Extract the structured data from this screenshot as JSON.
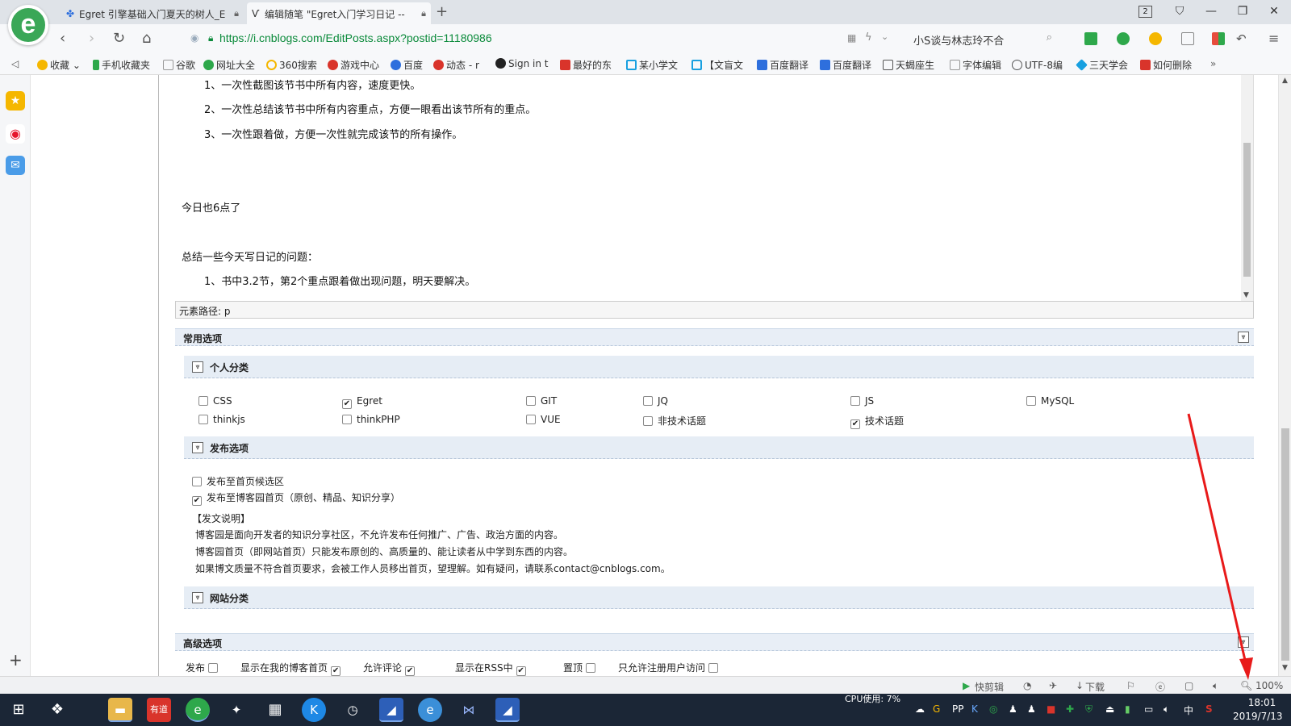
{
  "browser": {
    "tabs": [
      {
        "title": "Egret 引擎基础入门夏天的树人_E",
        "icon": "paw-icon"
      },
      {
        "title": "编辑随笔 \"Egret入门学习日记 --",
        "icon": "cnblogs-icon"
      }
    ],
    "tab_count": "2",
    "url": "https://i.cnblogs.com/EditPosts.aspx?postid=11180986",
    "search_text": "小S谈与林志玲不合",
    "accent_color": "#3aa757"
  },
  "bookmarks": [
    {
      "label": "收藏",
      "color": "#f5b700"
    },
    {
      "label": "手机收藏夹",
      "color": "#2ea84b"
    },
    {
      "label": "谷歌",
      "color": "#bbbbbb"
    },
    {
      "label": "网址大全",
      "color": "#2ea84b"
    },
    {
      "label": "360搜索",
      "color": "#f5b700"
    },
    {
      "label": "游戏中心",
      "color": "#d9342b"
    },
    {
      "label": "百度",
      "color": "#2e6fdd"
    },
    {
      "label": "动态 - r",
      "color": "#d9342b"
    },
    {
      "label": "Sign in t",
      "color": "#222222"
    },
    {
      "label": "最好的东",
      "color": "#d9342b"
    },
    {
      "label": "某小学文",
      "color": "#18a0e0"
    },
    {
      "label": "【文盲文",
      "color": "#18a0e0"
    },
    {
      "label": "百度翻译",
      "color": "#2e6fdd"
    },
    {
      "label": "百度翻译",
      "color": "#2e6fdd"
    },
    {
      "label": "天蝎座生",
      "color": "#555555"
    },
    {
      "label": "字体编辑",
      "color": "#bbbbbb"
    },
    {
      "label": "UTF-8编",
      "color": "#555555"
    },
    {
      "label": "三天学会",
      "color": "#18a0e0"
    },
    {
      "label": "如何删除",
      "color": "#d9342b"
    }
  ],
  "editor": {
    "lines": [
      "1、一次性截图该节书中所有内容，速度更快。",
      "2、一次性总结该节书中所有内容重点，方便一眼看出该节所有的重点。",
      "3、一次性跟着做，方便一次性就完成该节的所有操作。",
      "今日也6点了",
      "总结一些今天写日记的问题：",
      "1、书中3.2节，第2个重点跟着做出现问题，明天要解决。"
    ],
    "element_path": "元素路径: p"
  },
  "common_options": {
    "title": "常用选项",
    "personal_category": {
      "title": "个人分类",
      "items": [
        {
          "label": "CSS",
          "checked": false
        },
        {
          "label": "Egret",
          "checked": true
        },
        {
          "label": "GIT",
          "checked": false
        },
        {
          "label": "JQ",
          "checked": false
        },
        {
          "label": "JS",
          "checked": false
        },
        {
          "label": "MySQL",
          "checked": false
        },
        {
          "label": "thinkjs",
          "checked": false
        },
        {
          "label": "thinkPHP",
          "checked": false
        },
        {
          "label": "VUE",
          "checked": false
        },
        {
          "label": "非技术话题",
          "checked": false
        },
        {
          "label": "技术话题",
          "checked": true
        }
      ]
    },
    "publish_options": {
      "title": "发布选项",
      "opt1": {
        "label": "发布至首页候选区",
        "checked": false
      },
      "opt2": {
        "label": "发布至博客园首页（原创、精品、知识分享）",
        "checked": true
      },
      "notice_title": "【发文说明】",
      "notice_lines": [
        "博客园是面向开发者的知识分享社区，不允许发布任何推广、广告、政治方面的内容。",
        "博客园首页（即网站首页）只能发布原创的、高质量的、能让读者从中学到东西的内容。",
        "如果博文质量不符合首页要求，会被工作人员移出首页，望理解。如有疑问，请联系contact@cnblogs.com。"
      ]
    },
    "site_category": {
      "title": "网站分类"
    }
  },
  "advanced_options": {
    "title": "高级选项",
    "items": [
      "发布",
      "显示在我的博客首页",
      "允许评论",
      "显示在RSS中",
      "置顶",
      "只允许注册用户访问"
    ]
  },
  "statusbar": {
    "quick_cut": "快剪辑",
    "download": "下载",
    "zoom": "100%"
  },
  "taskbar": {
    "cpu": "CPU使用: 7%",
    "ime": "中",
    "time": "18:01",
    "date": "2019/7/13"
  }
}
